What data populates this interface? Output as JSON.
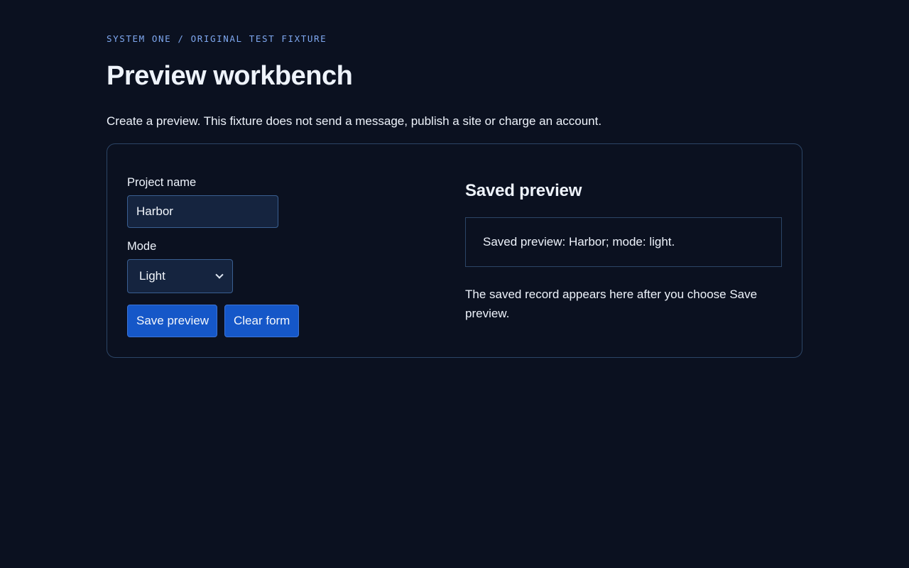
{
  "header": {
    "eyebrow": "SYSTEM ONE / ORIGINAL TEST FIXTURE",
    "title": "Preview workbench",
    "intro": "Create a preview. This fixture does not send a message, publish a site or charge an account."
  },
  "form": {
    "project_name_label": "Project name",
    "project_name_value": "Harbor",
    "mode_label": "Mode",
    "mode_selected": "Light",
    "save_label": "Save preview",
    "clear_label": "Clear form"
  },
  "preview": {
    "heading": "Saved preview",
    "output": "Saved preview: Harbor; mode: light.",
    "note": "The saved record appears here after you choose Save preview."
  },
  "colors": {
    "background": "#0b1120",
    "accent": "#1557c8",
    "eyebrow": "#7fa8f0",
    "border": "#2c4566",
    "input_bg": "#15243f"
  },
  "icons": {
    "mode_select_chevron": "chevron-down-icon"
  }
}
